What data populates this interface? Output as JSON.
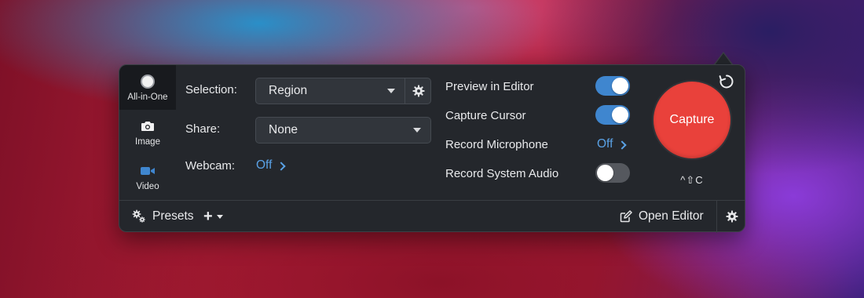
{
  "modes": [
    {
      "label": "All-in-One",
      "icon": "record-circle-icon",
      "active": true
    },
    {
      "label": "Image",
      "icon": "camera-icon",
      "active": false
    },
    {
      "label": "Video",
      "icon": "video-camera-icon",
      "active": false
    }
  ],
  "selection": {
    "label": "Selection:",
    "value": "Region"
  },
  "share": {
    "label": "Share:",
    "value": "None"
  },
  "webcam": {
    "label": "Webcam:",
    "value": "Off"
  },
  "options": {
    "preview_in_editor": {
      "label": "Preview in Editor",
      "on": true
    },
    "capture_cursor": {
      "label": "Capture Cursor",
      "on": true
    },
    "record_microphone": {
      "label": "Record Microphone",
      "value": "Off"
    },
    "record_system_audio": {
      "label": "Record System Audio",
      "on": false
    }
  },
  "capture": {
    "label": "Capture",
    "shortcut": "^⇧C"
  },
  "footer": {
    "presets_label": "Presets",
    "add_label": "+",
    "open_editor_label": "Open Editor"
  },
  "colors": {
    "accent_blue": "#3f86cf",
    "link_blue": "#5aa2e6",
    "capture_red": "#e9413b",
    "panel_bg": "#24272c"
  }
}
